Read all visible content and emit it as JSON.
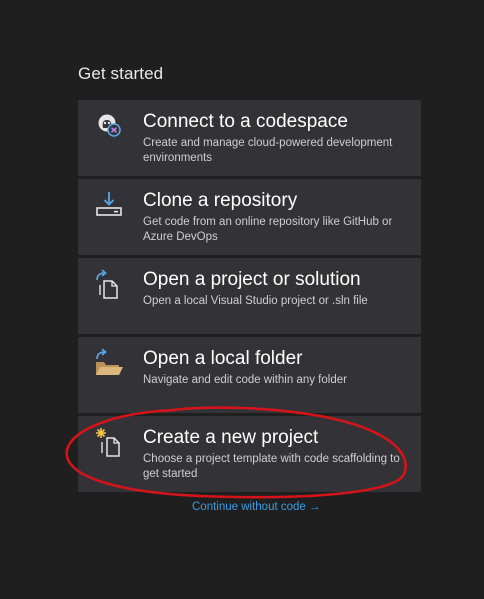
{
  "heading": "Get started",
  "cards": [
    {
      "id": "codespace",
      "icon": "codespace-icon",
      "title": "Connect to a codespace",
      "description": "Create and manage cloud-powered development environments"
    },
    {
      "id": "clone",
      "icon": "clone-download-icon",
      "title": "Clone a repository",
      "description": "Get code from an online repository like GitHub or Azure DevOps"
    },
    {
      "id": "open-project",
      "icon": "open-project-icon",
      "title": "Open a project or solution",
      "description": "Open a local Visual Studio project or .sln file"
    },
    {
      "id": "open-folder",
      "icon": "open-folder-icon",
      "title": "Open a local folder",
      "description": "Navigate and edit code within any folder"
    },
    {
      "id": "new-project",
      "icon": "new-project-icon",
      "title": "Create a new project",
      "description": "Choose a project template with code scaffolding to get started"
    }
  ],
  "continue_link": {
    "label": "Continue without code",
    "arrow": "→"
  },
  "colors": {
    "background": "#1f1f1f",
    "card": "#333337",
    "link": "#3b9ce4",
    "annotation": "#d4141a",
    "icon_blue": "#57a7e8",
    "folder": "#dcb67a",
    "sparkle": "#f2c744"
  }
}
